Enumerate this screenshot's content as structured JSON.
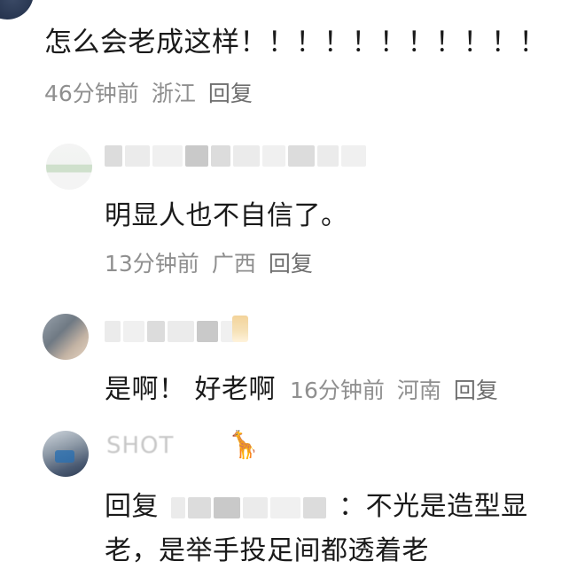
{
  "comments": [
    {
      "text": "怎么会老成这样！！！！！！！！！！！",
      "time": "46分钟前",
      "location": "浙江",
      "reply_label": "回复"
    },
    {
      "text": "明显人也不自信了。",
      "time": "13分钟前",
      "location": "广西",
      "reply_label": "回复"
    },
    {
      "text": "是啊！ 好老啊",
      "time": "16分钟前",
      "location": "河南",
      "reply_label": "回复"
    },
    {
      "username_partial": "SHOT",
      "emoji": "🦒",
      "reply_prefix": "回复",
      "text_line1": "：不光是造型显",
      "text_line2": "老，是举手投足间都透着老"
    }
  ],
  "colors": {
    "text": "#1a1a1a",
    "meta": "#8f8f8f",
    "background": "#ffffff"
  }
}
